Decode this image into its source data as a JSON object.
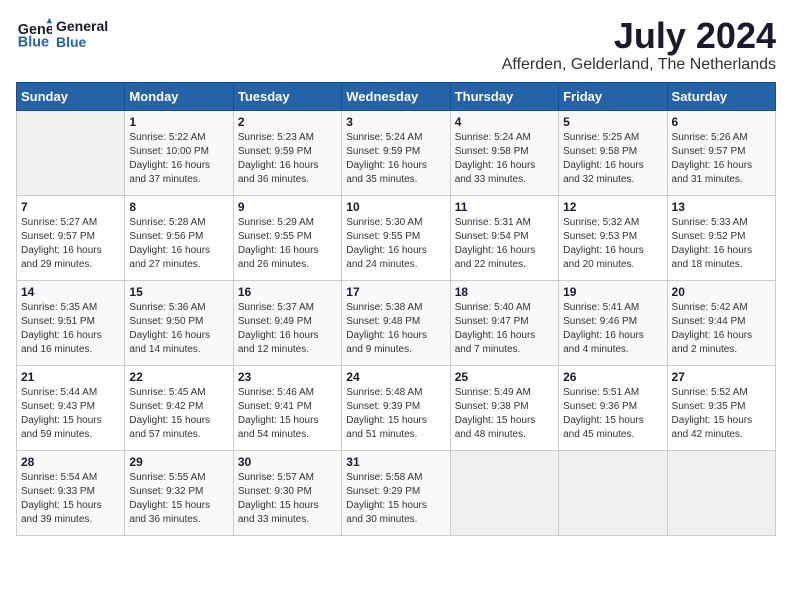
{
  "logo": {
    "line1": "General",
    "line2": "Blue"
  },
  "title": "July 2024",
  "location": "Afferden, Gelderland, The Netherlands",
  "days_of_week": [
    "Sunday",
    "Monday",
    "Tuesday",
    "Wednesday",
    "Thursday",
    "Friday",
    "Saturday"
  ],
  "weeks": [
    [
      {
        "day": "",
        "info": ""
      },
      {
        "day": "1",
        "info": "Sunrise: 5:22 AM\nSunset: 10:00 PM\nDaylight: 16 hours\nand 37 minutes."
      },
      {
        "day": "2",
        "info": "Sunrise: 5:23 AM\nSunset: 9:59 PM\nDaylight: 16 hours\nand 36 minutes."
      },
      {
        "day": "3",
        "info": "Sunrise: 5:24 AM\nSunset: 9:59 PM\nDaylight: 16 hours\nand 35 minutes."
      },
      {
        "day": "4",
        "info": "Sunrise: 5:24 AM\nSunset: 9:58 PM\nDaylight: 16 hours\nand 33 minutes."
      },
      {
        "day": "5",
        "info": "Sunrise: 5:25 AM\nSunset: 9:58 PM\nDaylight: 16 hours\nand 32 minutes."
      },
      {
        "day": "6",
        "info": "Sunrise: 5:26 AM\nSunset: 9:57 PM\nDaylight: 16 hours\nand 31 minutes."
      }
    ],
    [
      {
        "day": "7",
        "info": "Sunrise: 5:27 AM\nSunset: 9:57 PM\nDaylight: 16 hours\nand 29 minutes."
      },
      {
        "day": "8",
        "info": "Sunrise: 5:28 AM\nSunset: 9:56 PM\nDaylight: 16 hours\nand 27 minutes."
      },
      {
        "day": "9",
        "info": "Sunrise: 5:29 AM\nSunset: 9:55 PM\nDaylight: 16 hours\nand 26 minutes."
      },
      {
        "day": "10",
        "info": "Sunrise: 5:30 AM\nSunset: 9:55 PM\nDaylight: 16 hours\nand 24 minutes."
      },
      {
        "day": "11",
        "info": "Sunrise: 5:31 AM\nSunset: 9:54 PM\nDaylight: 16 hours\nand 22 minutes."
      },
      {
        "day": "12",
        "info": "Sunrise: 5:32 AM\nSunset: 9:53 PM\nDaylight: 16 hours\nand 20 minutes."
      },
      {
        "day": "13",
        "info": "Sunrise: 5:33 AM\nSunset: 9:52 PM\nDaylight: 16 hours\nand 18 minutes."
      }
    ],
    [
      {
        "day": "14",
        "info": "Sunrise: 5:35 AM\nSunset: 9:51 PM\nDaylight: 16 hours\nand 16 minutes."
      },
      {
        "day": "15",
        "info": "Sunrise: 5:36 AM\nSunset: 9:50 PM\nDaylight: 16 hours\nand 14 minutes."
      },
      {
        "day": "16",
        "info": "Sunrise: 5:37 AM\nSunset: 9:49 PM\nDaylight: 16 hours\nand 12 minutes."
      },
      {
        "day": "17",
        "info": "Sunrise: 5:38 AM\nSunset: 9:48 PM\nDaylight: 16 hours\nand 9 minutes."
      },
      {
        "day": "18",
        "info": "Sunrise: 5:40 AM\nSunset: 9:47 PM\nDaylight: 16 hours\nand 7 minutes."
      },
      {
        "day": "19",
        "info": "Sunrise: 5:41 AM\nSunset: 9:46 PM\nDaylight: 16 hours\nand 4 minutes."
      },
      {
        "day": "20",
        "info": "Sunrise: 5:42 AM\nSunset: 9:44 PM\nDaylight: 16 hours\nand 2 minutes."
      }
    ],
    [
      {
        "day": "21",
        "info": "Sunrise: 5:44 AM\nSunset: 9:43 PM\nDaylight: 15 hours\nand 59 minutes."
      },
      {
        "day": "22",
        "info": "Sunrise: 5:45 AM\nSunset: 9:42 PM\nDaylight: 15 hours\nand 57 minutes."
      },
      {
        "day": "23",
        "info": "Sunrise: 5:46 AM\nSunset: 9:41 PM\nDaylight: 15 hours\nand 54 minutes."
      },
      {
        "day": "24",
        "info": "Sunrise: 5:48 AM\nSunset: 9:39 PM\nDaylight: 15 hours\nand 51 minutes."
      },
      {
        "day": "25",
        "info": "Sunrise: 5:49 AM\nSunset: 9:38 PM\nDaylight: 15 hours\nand 48 minutes."
      },
      {
        "day": "26",
        "info": "Sunrise: 5:51 AM\nSunset: 9:36 PM\nDaylight: 15 hours\nand 45 minutes."
      },
      {
        "day": "27",
        "info": "Sunrise: 5:52 AM\nSunset: 9:35 PM\nDaylight: 15 hours\nand 42 minutes."
      }
    ],
    [
      {
        "day": "28",
        "info": "Sunrise: 5:54 AM\nSunset: 9:33 PM\nDaylight: 15 hours\nand 39 minutes."
      },
      {
        "day": "29",
        "info": "Sunrise: 5:55 AM\nSunset: 9:32 PM\nDaylight: 15 hours\nand 36 minutes."
      },
      {
        "day": "30",
        "info": "Sunrise: 5:57 AM\nSunset: 9:30 PM\nDaylight: 15 hours\nand 33 minutes."
      },
      {
        "day": "31",
        "info": "Sunrise: 5:58 AM\nSunset: 9:29 PM\nDaylight: 15 hours\nand 30 minutes."
      },
      {
        "day": "",
        "info": ""
      },
      {
        "day": "",
        "info": ""
      },
      {
        "day": "",
        "info": ""
      }
    ]
  ]
}
